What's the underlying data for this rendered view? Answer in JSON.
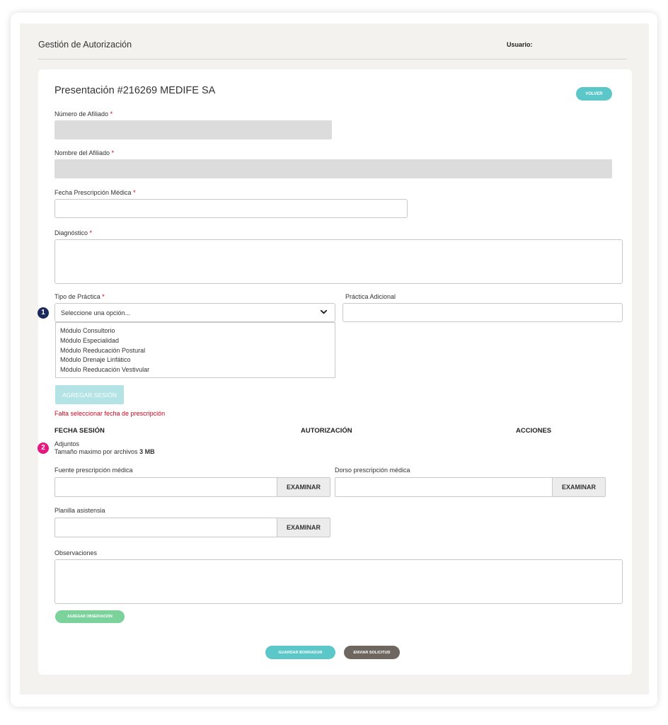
{
  "header": {
    "title": "Gestión de Autorización",
    "user_label": "Usuario:"
  },
  "form": {
    "title": "Presentación #216269 MEDIFE SA",
    "volver_label": "VOLVER",
    "required_mark": "*",
    "afiliado_numero": {
      "label": "Número de Afiliado",
      "value": ""
    },
    "afiliado_nombre": {
      "label": "Nombre del Afiliado",
      "value": ""
    },
    "fecha_prescripcion": {
      "label": "Fecha Prescripción Médica",
      "value": ""
    },
    "diagnostico": {
      "label": "Diagnóstico",
      "value": ""
    },
    "tipo_practica": {
      "label": "Tipo de Práctica",
      "selected": "Seleccione una opción...",
      "options": [
        "Módulo Consultorio",
        "Módulo Especialidad",
        "Módulo Reeducación Postural",
        "Módulo Drenaje Linfático",
        "Módulo Reeducación Vestivular"
      ]
    },
    "practica_adicional": {
      "label": "Práctica Adicional",
      "value": ""
    },
    "agregar_sesion_label": "AGREGAR SESIÓN",
    "error_message": "Falta seleccionar fecha de prescripción",
    "table_headers": [
      "FECHA SESIÓN",
      "AUTORIZACIÓN",
      "ACCIONES"
    ],
    "adjuntos": {
      "title": "Adjuntos",
      "size_note": "Tamaño maximo por archivos",
      "size_value": "3 MB"
    },
    "fuente": {
      "label": "Fuente prescripción médica",
      "button": "EXAMINAR"
    },
    "dorso": {
      "label": "Dorso prescripción médica",
      "button": "EXAMINAR"
    },
    "planilla": {
      "label": "Planilla asistensia",
      "button": "EXAMINAR"
    },
    "observaciones": {
      "label": "Observaciones",
      "value": ""
    },
    "agregar_observacion_label": "AGREGAR OBSERVACIÓN",
    "guardar_label": "GUARDAR BORRADOR",
    "enviar_label": "ENVIAR SOLICITUD"
  },
  "annotations": [
    {
      "number": "1",
      "color": "#1b2a5e"
    },
    {
      "number": "2",
      "color": "#e6177e"
    }
  ],
  "colors": {
    "teal": "#5bc7c9",
    "green": "#7bd29b",
    "brown": "#6f6660",
    "error": "#d0021b"
  }
}
